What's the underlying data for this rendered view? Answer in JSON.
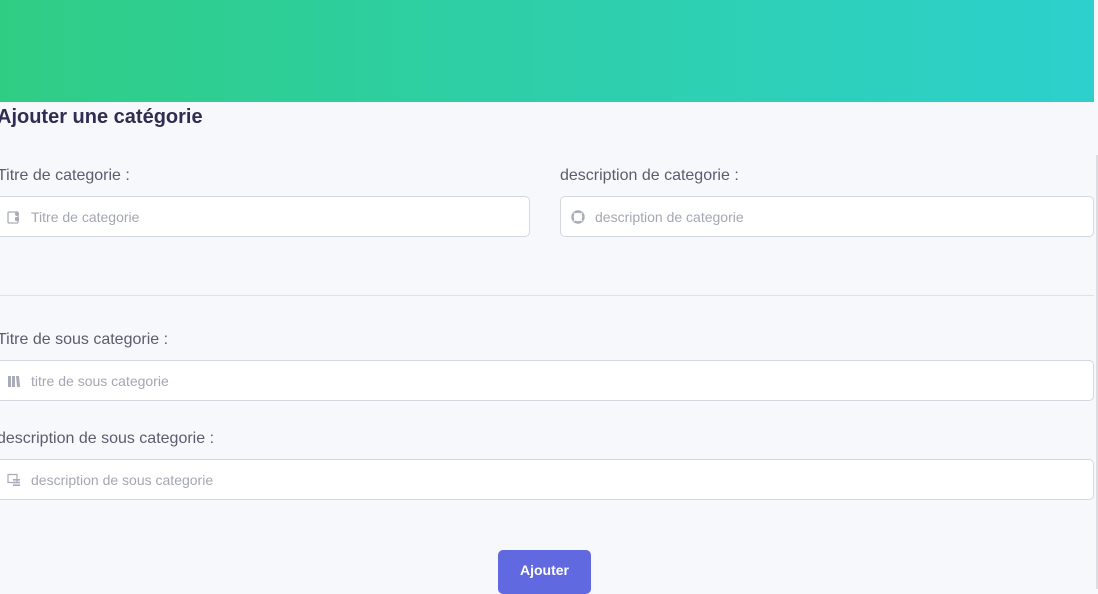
{
  "page": {
    "title": "Ajouter une catégorie"
  },
  "form": {
    "category_title": {
      "label": "Titre de categorie :",
      "placeholder": "Titre de categorie",
      "value": "",
      "icon": "contact-card-icon"
    },
    "category_description": {
      "label": "description de categorie :",
      "placeholder": "description de categorie",
      "value": "",
      "icon": "lifebuoy-icon"
    },
    "subcategory_title": {
      "label": "Titre de sous categorie :",
      "placeholder": "titre de sous categorie",
      "value": "",
      "icon": "books-icon"
    },
    "subcategory_description": {
      "label": "description de sous categorie :",
      "placeholder": "description de sous categorie",
      "value": "",
      "icon": "list-window-icon"
    },
    "submit_label": "Ajouter"
  },
  "colors": {
    "banner_start": "#2fcd84",
    "banner_end": "#2dd0cc",
    "accent": "#6069e0",
    "title": "#2f2d51"
  }
}
